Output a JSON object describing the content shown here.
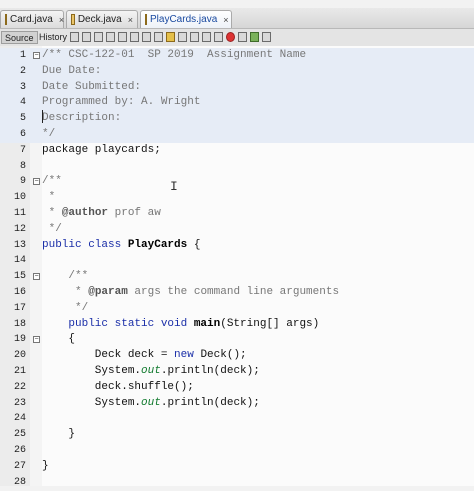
{
  "tabs": [
    {
      "label": "Card.java",
      "close": "×",
      "active": false
    },
    {
      "label": "Deck.java",
      "close": "×",
      "active": false
    },
    {
      "label": "PlayCards.java",
      "close": "×",
      "active": true
    }
  ],
  "toolbar": {
    "source_label": "Source",
    "history_label": "History"
  },
  "code_lines": [
    {
      "n": "1",
      "segments": [
        {
          "t": "/** CSC-122-01  SP 2019  Assignment Name",
          "c": "comment"
        }
      ]
    },
    {
      "n": "2",
      "segments": [
        {
          "t": "Due Date:",
          "c": "comment"
        }
      ]
    },
    {
      "n": "3",
      "segments": [
        {
          "t": "Date Submitted:",
          "c": "comment"
        }
      ]
    },
    {
      "n": "4",
      "segments": [
        {
          "t": "Programmed by: A. Wright",
          "c": "comment"
        }
      ]
    },
    {
      "n": "5",
      "segments": [
        {
          "t": "Description:",
          "c": "comment"
        }
      ]
    },
    {
      "n": "6",
      "segments": [
        {
          "t": "*/",
          "c": "comment"
        }
      ]
    },
    {
      "n": "7",
      "segments": [
        {
          "t": "package playcards;",
          "c": "plain"
        }
      ]
    },
    {
      "n": "8",
      "segments": []
    },
    {
      "n": "9",
      "segments": [
        {
          "t": "/**",
          "c": "comment"
        }
      ]
    },
    {
      "n": "10",
      "segments": [
        {
          "t": " *",
          "c": "comment"
        }
      ]
    },
    {
      "n": "11",
      "segments": [
        {
          "t": " * ",
          "c": "comment"
        },
        {
          "t": "@author",
          "c": "doc-tag"
        },
        {
          "t": " prof aw",
          "c": "comment"
        }
      ]
    },
    {
      "n": "12",
      "segments": [
        {
          "t": " */",
          "c": "comment"
        }
      ]
    },
    {
      "n": "13",
      "segments": [
        {
          "t": "public class ",
          "c": "kw"
        },
        {
          "t": "PlayCards",
          "c": "cls"
        },
        {
          "t": " {",
          "c": "plain"
        }
      ]
    },
    {
      "n": "14",
      "segments": []
    },
    {
      "n": "15",
      "segments": [
        {
          "t": "    /**",
          "c": "comment"
        }
      ]
    },
    {
      "n": "16",
      "segments": [
        {
          "t": "     * ",
          "c": "comment"
        },
        {
          "t": "@param",
          "c": "doc-tag"
        },
        {
          "t": " args the command line arguments",
          "c": "comment"
        }
      ]
    },
    {
      "n": "17",
      "segments": [
        {
          "t": "     */",
          "c": "comment"
        }
      ]
    },
    {
      "n": "18",
      "segments": [
        {
          "t": "    public static void ",
          "c": "kw"
        },
        {
          "t": "main",
          "c": "fn"
        },
        {
          "t": "(String[] args)",
          "c": "plain"
        }
      ]
    },
    {
      "n": "19",
      "segments": [
        {
          "t": "    {",
          "c": "plain"
        }
      ]
    },
    {
      "n": "20",
      "segments": [
        {
          "t": "        Deck deck = ",
          "c": "plain"
        },
        {
          "t": "new",
          "c": "kw"
        },
        {
          "t": " Deck();",
          "c": "plain"
        }
      ]
    },
    {
      "n": "21",
      "segments": [
        {
          "t": "        System.",
          "c": "plain"
        },
        {
          "t": "out",
          "c": "fld"
        },
        {
          "t": ".println(deck);",
          "c": "plain"
        }
      ]
    },
    {
      "n": "22",
      "segments": [
        {
          "t": "        deck.shuffle();",
          "c": "plain"
        }
      ]
    },
    {
      "n": "23",
      "segments": [
        {
          "t": "        System.",
          "c": "plain"
        },
        {
          "t": "out",
          "c": "fld"
        },
        {
          "t": ".println(deck);",
          "c": "plain"
        }
      ]
    },
    {
      "n": "24",
      "segments": []
    },
    {
      "n": "25",
      "segments": [
        {
          "t": "    }",
          "c": "plain"
        }
      ]
    },
    {
      "n": "26",
      "segments": []
    },
    {
      "n": "27",
      "segments": [
        {
          "t": "}",
          "c": "plain"
        }
      ]
    },
    {
      "n": "28",
      "segments": []
    }
  ],
  "highlighted_lines": [
    "1",
    "2",
    "3",
    "4",
    "5",
    "6"
  ],
  "fold_markers": [
    "1",
    "9",
    "15",
    "19"
  ],
  "colors": {
    "keyword": "#1a2ea8",
    "comment": "#777777",
    "field": "#117a2e",
    "highlight": "#e6ecf6"
  },
  "icons": [
    "java-file-icon",
    "close-icon",
    "mouse-ibeam-icon"
  ]
}
